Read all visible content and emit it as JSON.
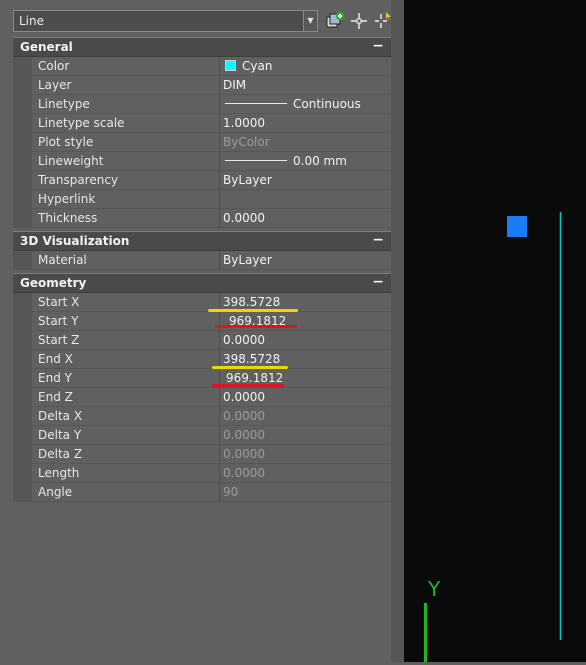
{
  "selector": {
    "value": "Line"
  },
  "toolbar": {
    "icons": [
      "quick-select-icon",
      "pick-objects-icon",
      "toggle-pickadd-icon"
    ]
  },
  "sections": {
    "general": {
      "title": "General",
      "toggle": "−",
      "rows": [
        {
          "label": "Color",
          "value": "Cyan"
        },
        {
          "label": "Layer",
          "value": "DIM"
        },
        {
          "label": "Linetype",
          "value": "Continuous"
        },
        {
          "label": "Linetype scale",
          "value": "1.0000"
        },
        {
          "label": "Plot style",
          "value": "ByColor"
        },
        {
          "label": "Lineweight",
          "value": "0.00 mm"
        },
        {
          "label": "Transparency",
          "value": "ByLayer"
        },
        {
          "label": "Hyperlink",
          "value": ""
        },
        {
          "label": "Thickness",
          "value": "0.0000"
        }
      ]
    },
    "visualization": {
      "title": "3D Visualization",
      "toggle": "−",
      "rows": [
        {
          "label": "Material",
          "value": "ByLayer"
        }
      ]
    },
    "geometry": {
      "title": "Geometry",
      "toggle": "−",
      "rows": [
        {
          "label": "Start X",
          "value": "398.5728"
        },
        {
          "label": "Start Y",
          "value": "969.1812"
        },
        {
          "label": "Start Z",
          "value": "0.0000"
        },
        {
          "label": "End X",
          "value": "398.5728"
        },
        {
          "label": "End Y",
          "value": "969.1812"
        },
        {
          "label": "End Z",
          "value": "0.0000"
        },
        {
          "label": "Delta X",
          "value": "0.0000"
        },
        {
          "label": "Delta Y",
          "value": "0.0000"
        },
        {
          "label": "Delta Z",
          "value": "0.0000"
        },
        {
          "label": "Length",
          "value": "0.0000"
        },
        {
          "label": "Angle",
          "value": "90"
        }
      ]
    }
  },
  "colors": {
    "cyan_swatch": "#00ffff",
    "highlight_yellow": "#f2d500",
    "highlight_red": "#e0141e",
    "grip_blue": "#1a7cf5",
    "ucs_green": "#22b522",
    "selected_line": "#00c8c8"
  },
  "canvas": {
    "ucs_axis_label": "Y"
  }
}
